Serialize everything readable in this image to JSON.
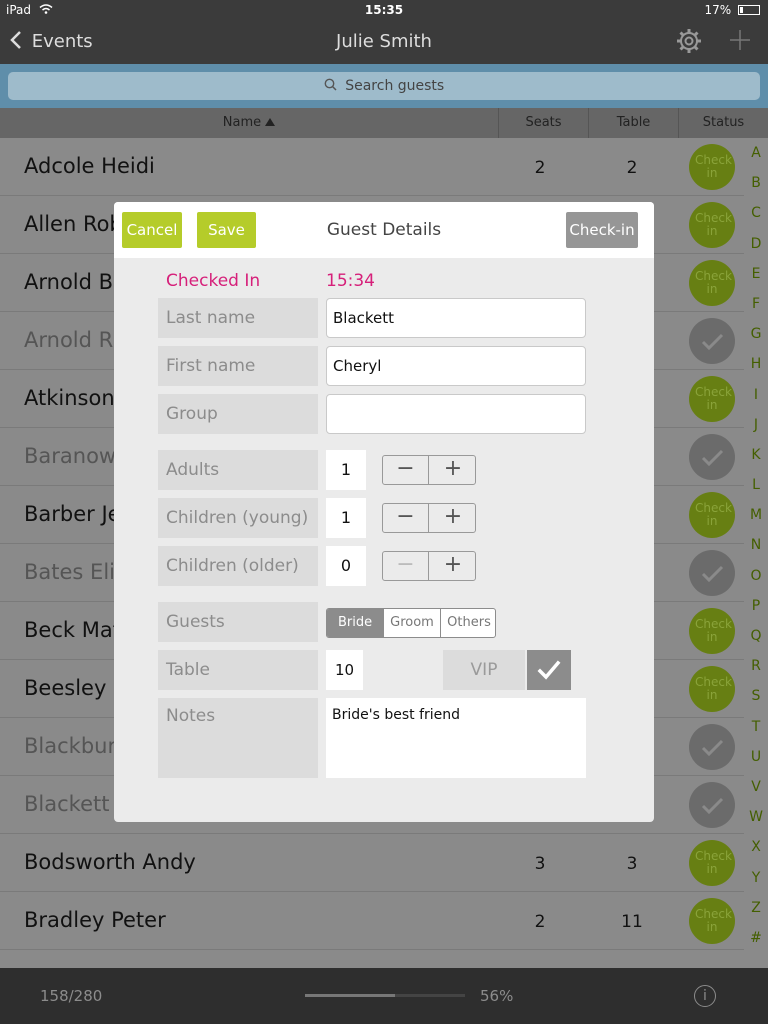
{
  "status_bar": {
    "device": "iPad",
    "time": "15:35",
    "battery": "17%"
  },
  "nav": {
    "back_label": "Events",
    "title": "Julie Smith"
  },
  "search": {
    "placeholder": "Search guests"
  },
  "table_header": {
    "name": "Name",
    "seats": "Seats",
    "table": "Table",
    "status": "Status"
  },
  "status_labels": {
    "check_in": "Check in"
  },
  "rows": [
    {
      "name": "Adcole Heidi",
      "seats": "2",
      "table": "2",
      "status": "check-in",
      "dim": false
    },
    {
      "name": "Allen Rob",
      "seats": "",
      "table": "",
      "status": "check-in",
      "dim": false
    },
    {
      "name": "Arnold Bo",
      "seats": "",
      "table": "",
      "status": "check-in",
      "dim": false
    },
    {
      "name": "Arnold Ru",
      "seats": "",
      "table": "",
      "status": "checked",
      "dim": true
    },
    {
      "name": "Atkinson",
      "seats": "",
      "table": "",
      "status": "check-in",
      "dim": false
    },
    {
      "name": "Baranow",
      "seats": "",
      "table": "",
      "status": "checked",
      "dim": true
    },
    {
      "name": "Barber Je",
      "seats": "",
      "table": "",
      "status": "check-in",
      "dim": false
    },
    {
      "name": "Bates Eliz",
      "seats": "",
      "table": "",
      "status": "checked",
      "dim": true
    },
    {
      "name": "Beck Mat",
      "seats": "",
      "table": "",
      "status": "check-in",
      "dim": false
    },
    {
      "name": "Beesley F",
      "seats": "",
      "table": "",
      "status": "check-in",
      "dim": false
    },
    {
      "name": "Blackburn",
      "seats": "",
      "table": "",
      "status": "checked",
      "dim": true
    },
    {
      "name": "Blackett C",
      "seats": "",
      "table": "",
      "status": "checked",
      "dim": true
    },
    {
      "name": "Bodsworth Andy",
      "seats": "3",
      "table": "3",
      "status": "check-in",
      "dim": false
    },
    {
      "name": "Bradley Peter",
      "seats": "2",
      "table": "11",
      "status": "check-in",
      "dim": false
    }
  ],
  "index_letters": [
    "A",
    "B",
    "C",
    "D",
    "E",
    "F",
    "G",
    "H",
    "I",
    "J",
    "K",
    "L",
    "M",
    "N",
    "O",
    "P",
    "Q",
    "R",
    "S",
    "T",
    "U",
    "V",
    "W",
    "X",
    "Y",
    "Z",
    "#"
  ],
  "bottom": {
    "count": "158/280",
    "percent_label": "56%",
    "progress": 0.56
  },
  "modal": {
    "cancel": "Cancel",
    "save": "Save",
    "title": "Guest Details",
    "check_in": "Check-in",
    "checked_in_label": "Checked In",
    "checked_in_time": "15:34",
    "fields": {
      "last_name_label": "Last name",
      "last_name_value": "Blackett",
      "first_name_label": "First name",
      "first_name_value": "Cheryl",
      "group_label": "Group",
      "group_value": "",
      "adults_label": "Adults",
      "adults_value": "1",
      "children_young_label": "Children (young)",
      "children_young_value": "1",
      "children_older_label": "Children (older)",
      "children_older_value": "0",
      "guests_label": "Guests",
      "guests_options": [
        "Bride",
        "Groom",
        "Others"
      ],
      "guests_selected": "Bride",
      "table_label": "Table",
      "table_value": "10",
      "vip_label": "VIP",
      "vip_checked": true,
      "notes_label": "Notes",
      "notes_value": "Bride's best friend"
    },
    "stepper": {
      "minus": "−",
      "plus": "+"
    }
  },
  "colors": {
    "accent_green": "#b5cc2a",
    "checked_in_pink": "#d6207a",
    "status_green": "#677f13"
  },
  "icons": {
    "back": "chevron-left-icon",
    "settings": "gear-icon",
    "add": "plus-icon",
    "search": "search-icon",
    "info": "info-icon",
    "check": "checkmark-icon"
  }
}
